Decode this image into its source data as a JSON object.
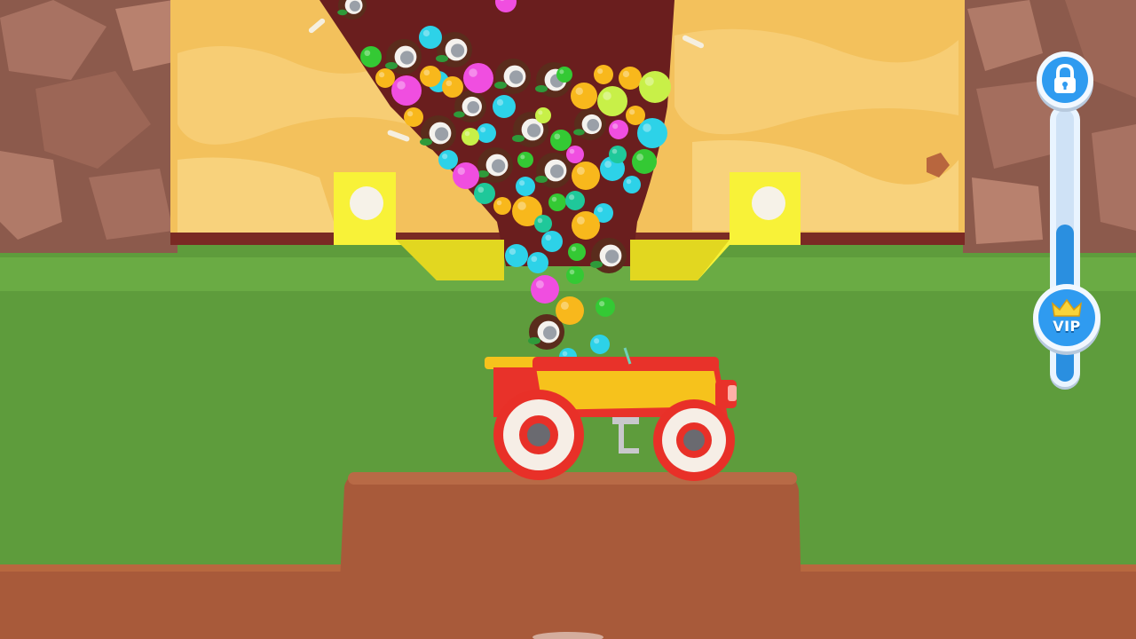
{
  "hud": {
    "lock_icon": "lock-icon",
    "vip_label": "VIP",
    "crown_icon": "crown-icon",
    "progress_fraction": 0.58
  },
  "colors": {
    "grass": "#5e9c3c",
    "sand": "#f3c15c",
    "dirt_tunnel": "#6a1e1e",
    "rock_wall": "#9c6a5c",
    "truck_body": "#e8322a",
    "truck_panel": "#f6c21c",
    "gate": "#f8f238",
    "accent_blue": "#2f9bf0"
  },
  "balls": [
    {
      "type": "coconut",
      "color": "#5a2c1c"
    },
    {
      "type": "ball",
      "color": "#2dd2e8"
    },
    {
      "type": "ball",
      "color": "#f04ee0"
    },
    {
      "type": "ball",
      "color": "#f8b81c"
    },
    {
      "type": "ball",
      "color": "#34c934"
    },
    {
      "type": "ball",
      "color": "#c8f048"
    },
    {
      "type": "ball",
      "color": "#1fc89a"
    }
  ]
}
